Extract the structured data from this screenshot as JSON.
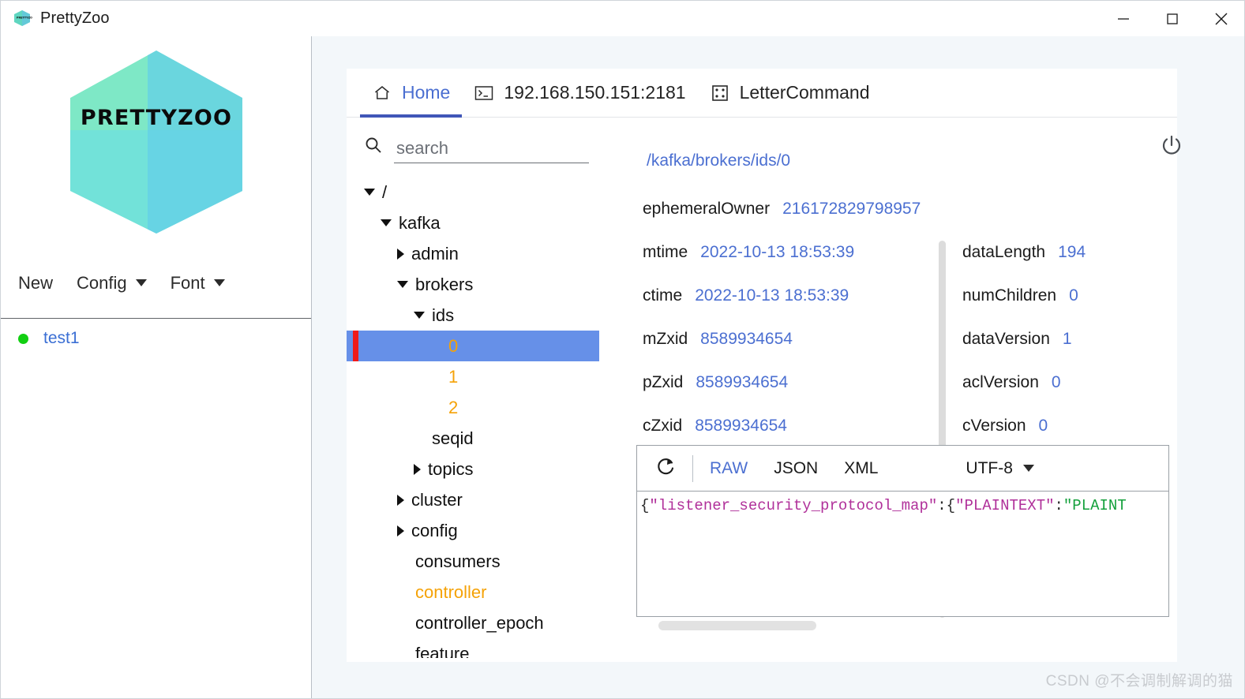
{
  "window": {
    "title": "PrettyZoo",
    "logo_icon": "prettyzoo-hexagon-logo",
    "minimize_label": "Minimize",
    "maximize_label": "Maximize",
    "close_label": "Close"
  },
  "brand": {
    "logo_text": "PRETTYZOO",
    "colors": {
      "green": "#5ce0b0",
      "cyan": "#6fd8e8",
      "teal": "#46ccc6",
      "accent_blue": "#4b6fd1",
      "selection_blue": "#6690e8",
      "ephemeral_orange": "#f5a207",
      "marker_red": "#f01a1a",
      "status_green": "#12cf12"
    }
  },
  "left_toolbar": {
    "items": [
      {
        "label": "New",
        "has_caret": false
      },
      {
        "label": "Config",
        "has_caret": true
      },
      {
        "label": "Font",
        "has_caret": true
      }
    ]
  },
  "servers": [
    {
      "name": "test1",
      "status": "connected"
    }
  ],
  "tabs": [
    {
      "label": "Home",
      "icon": "home-icon",
      "active": true
    },
    {
      "label": "192.168.150.151:2181",
      "icon": "terminal-icon",
      "active": false
    },
    {
      "label": "LetterCommand",
      "icon": "dice-icon",
      "active": false
    }
  ],
  "search": {
    "placeholder": "search",
    "value": "",
    "icon": "search-icon"
  },
  "tree": [
    {
      "label": "/",
      "depth": 0,
      "state": "open",
      "selected": false,
      "ephemeral": false
    },
    {
      "label": "kafka",
      "depth": 1,
      "state": "open",
      "selected": false,
      "ephemeral": false
    },
    {
      "label": "admin",
      "depth": 2,
      "state": "closed",
      "selected": false,
      "ephemeral": false
    },
    {
      "label": "brokers",
      "depth": 2,
      "state": "open",
      "selected": false,
      "ephemeral": false
    },
    {
      "label": "ids",
      "depth": 3,
      "state": "open",
      "selected": false,
      "ephemeral": false
    },
    {
      "label": "0",
      "depth": 4,
      "state": "leaf",
      "selected": true,
      "ephemeral": true
    },
    {
      "label": "1",
      "depth": 4,
      "state": "leaf",
      "selected": false,
      "ephemeral": true
    },
    {
      "label": "2",
      "depth": 4,
      "state": "leaf",
      "selected": false,
      "ephemeral": true
    },
    {
      "label": "seqid",
      "depth": 3,
      "state": "leaf",
      "selected": false,
      "ephemeral": false
    },
    {
      "label": "topics",
      "depth": 3,
      "state": "closed",
      "selected": false,
      "ephemeral": false
    },
    {
      "label": "cluster",
      "depth": 2,
      "state": "closed",
      "selected": false,
      "ephemeral": false
    },
    {
      "label": "config",
      "depth": 2,
      "state": "closed",
      "selected": false,
      "ephemeral": false
    },
    {
      "label": "consumers",
      "depth": 2,
      "state": "leaf",
      "selected": false,
      "ephemeral": false
    },
    {
      "label": "controller",
      "depth": 2,
      "state": "leaf",
      "selected": false,
      "ephemeral": true
    },
    {
      "label": "controller_epoch",
      "depth": 2,
      "state": "leaf",
      "selected": false,
      "ephemeral": false
    },
    {
      "label": "feature",
      "depth": 2,
      "state": "leaf",
      "selected": false,
      "ephemeral": false
    }
  ],
  "detail": {
    "node_path": "/kafka/brokers/ids/0",
    "power_icon": "power-icon",
    "properties": [
      {
        "key": "ephemeralOwner",
        "value": "216172829798957",
        "clipped": true,
        "full_row": true
      },
      {
        "key": "mtime",
        "value": "2022-10-13 18:53:39"
      },
      {
        "key": "dataLength",
        "value": "194"
      },
      {
        "key": "ctime",
        "value": "2022-10-13 18:53:39"
      },
      {
        "key": "numChildren",
        "value": "0"
      },
      {
        "key": "mZxid",
        "value": "8589934654"
      },
      {
        "key": "dataVersion",
        "value": "1"
      },
      {
        "key": "pZxid",
        "value": "8589934654"
      },
      {
        "key": "aclVersion",
        "value": "0"
      },
      {
        "key": "cZxid",
        "value": "8589934654"
      },
      {
        "key": "cVersion",
        "value": "0"
      }
    ],
    "property_rows": [
      {
        "left_key": "ephemeralOwner",
        "left_value": "216172829798957",
        "right_key": "",
        "right_value": ""
      },
      {
        "left_key": "mtime",
        "left_value": "2022-10-13 18:53:39",
        "right_key": "dataLength",
        "right_value": "194"
      },
      {
        "left_key": "ctime",
        "left_value": "2022-10-13 18:53:39",
        "right_key": "numChildren",
        "right_value": "0"
      },
      {
        "left_key": "mZxid",
        "left_value": "8589934654",
        "right_key": "dataVersion",
        "right_value": "1"
      },
      {
        "left_key": "pZxid",
        "left_value": "8589934654",
        "right_key": "aclVersion",
        "right_value": "0"
      },
      {
        "left_key": "cZxid",
        "left_value": "8589934654",
        "right_key": "cVersion",
        "right_value": "0"
      }
    ]
  },
  "editor": {
    "refresh_icon": "refresh-icon",
    "formats": [
      {
        "label": "RAW",
        "active": true
      },
      {
        "label": "JSON",
        "active": false
      },
      {
        "label": "XML",
        "active": false
      }
    ],
    "encoding": "UTF-8",
    "encoding_caret": "chevron-down-icon",
    "content_tokens": [
      {
        "text": "{",
        "type": "punct"
      },
      {
        "text": "\"listener_security_protocol_map\"",
        "type": "key"
      },
      {
        "text": ":{",
        "type": "punct"
      },
      {
        "text": "\"PLAINTEXT\"",
        "type": "key"
      },
      {
        "text": ":",
        "type": "punct"
      },
      {
        "text": "\"PLAINT",
        "type": "str"
      }
    ],
    "content_raw": "{\"listener_security_protocol_map\":{\"PLAINTEXT\":\"PLAINT"
  },
  "watermark": "CSDN @不会调制解调的猫"
}
